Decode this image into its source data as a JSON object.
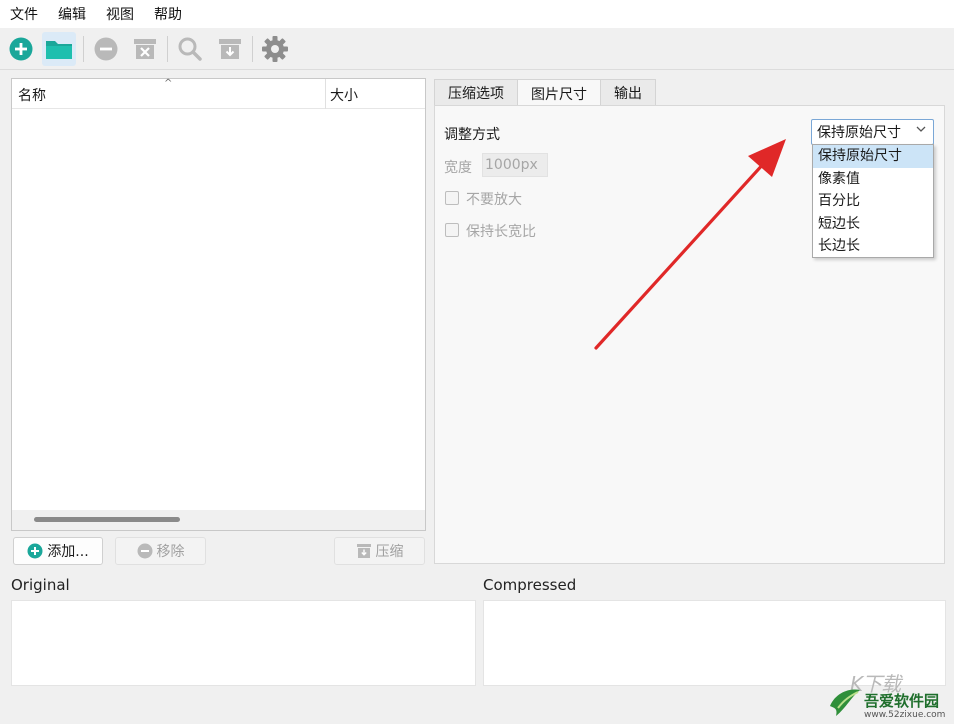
{
  "menubar": {
    "items": [
      "文件",
      "编辑",
      "视图",
      "帮助"
    ]
  },
  "toolbar": {
    "buttons": [
      "add-icon",
      "open-folder-icon",
      "remove-icon",
      "clear-icon",
      "search-icon",
      "compress-icon",
      "settings-icon"
    ],
    "accent_color": "#1aa79a"
  },
  "file_list": {
    "columns": [
      "名称",
      "大小"
    ],
    "sort_indicator": "^",
    "rows": []
  },
  "file_actions": {
    "add_label": "添加...",
    "remove_label": "移除",
    "compress_label": "压缩"
  },
  "tabs": [
    "压缩选项",
    "图片尺寸",
    "输出"
  ],
  "active_tab": "图片尺寸",
  "resize": {
    "mode_label": "调整方式",
    "mode_value": "保持原始尺寸",
    "width_label": "宽度",
    "width_value": "1000px",
    "no_enlarge_label": "不要放大",
    "keep_ratio_label": "保持长宽比",
    "dropdown_options": [
      "保持原始尺寸",
      "像素值",
      "百分比",
      "短边长",
      "长边长"
    ]
  },
  "preview": {
    "original_label": "Original",
    "compressed_label": "Compressed"
  },
  "annotation": {
    "arrow_color": "#e02828"
  },
  "watermark": {
    "top_text": "K下载",
    "brand": "吾爱软件园",
    "url": "www.52zixue.com"
  }
}
